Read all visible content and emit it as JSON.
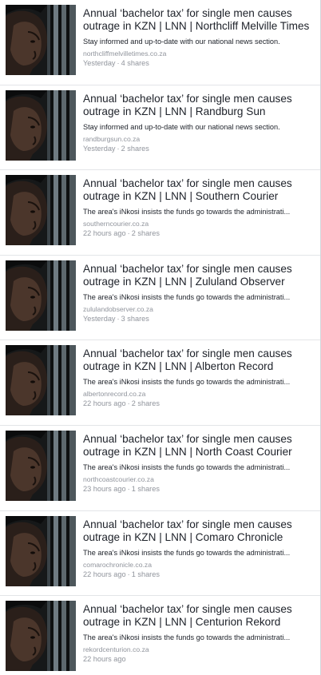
{
  "feed": {
    "items": [
      {
        "title": "Annual ‘bachelor tax’ for single men causes outrage in KZN | LNN | Northcliff Melville Times",
        "description": "Stay informed and up-to-date with our national news section.",
        "domain": "northcliffmelvilletimes.co.za",
        "time": "Yesterday",
        "shares": "4 shares"
      },
      {
        "title": "Annual ‘bachelor tax’ for single men causes outrage in KZN | LNN | Randburg Sun",
        "description": "Stay informed and up-to-date with our national news section.",
        "domain": "randburgsun.co.za",
        "time": "Yesterday",
        "shares": "2 shares"
      },
      {
        "title": "Annual ‘bachelor tax’ for single men causes outrage in KZN | LNN | Southern Courier",
        "description": "The area's iNkosi insists the funds go towards the administrati...",
        "domain": "southerncourier.co.za",
        "time": "22 hours ago",
        "shares": "2 shares"
      },
      {
        "title": "Annual ‘bachelor tax’ for single men causes outrage in KZN | LNN | Zululand Observer",
        "description": "The area's iNkosi insists the funds go towards the administrati...",
        "domain": "zululandobserver.co.za",
        "time": "Yesterday",
        "shares": "3 shares"
      },
      {
        "title": "Annual ‘bachelor tax’ for single men causes outrage in KZN | LNN | Alberton Record",
        "description": "The area's iNkosi insists the funds go towards the administrati...",
        "domain": "albertonrecord.co.za",
        "time": "22 hours ago",
        "shares": "2 shares"
      },
      {
        "title": "Annual ‘bachelor tax’ for single men causes outrage in KZN | LNN | North Coast Courier",
        "description": "The area's iNkosi insists the funds go towards the administrati...",
        "domain": "northcoastcourier.co.za",
        "time": "23 hours ago",
        "shares": "1 shares"
      },
      {
        "title": "Annual ‘bachelor tax’ for single men causes outrage in KZN | LNN | Comaro Chronicle",
        "description": "The area's iNkosi insists the funds go towards the administrati...",
        "domain": "comarochronicle.co.za",
        "time": "22 hours ago",
        "shares": "1 shares"
      },
      {
        "title": "Annual ‘bachelor tax’ for single men causes outrage in KZN | LNN | Centurion Rekord",
        "description": "The area's iNkosi insists the funds go towards the administrati...",
        "domain": "rekordcenturion.co.za",
        "time": "22 hours ago",
        "shares": ""
      }
    ],
    "meta_separator": "·"
  },
  "colors": {
    "title_text": "#1d2129",
    "muted_text": "#90949c",
    "divider": "#e3e5e8"
  },
  "thumbnail": {
    "icon": "man-portrait-thumbnail"
  }
}
